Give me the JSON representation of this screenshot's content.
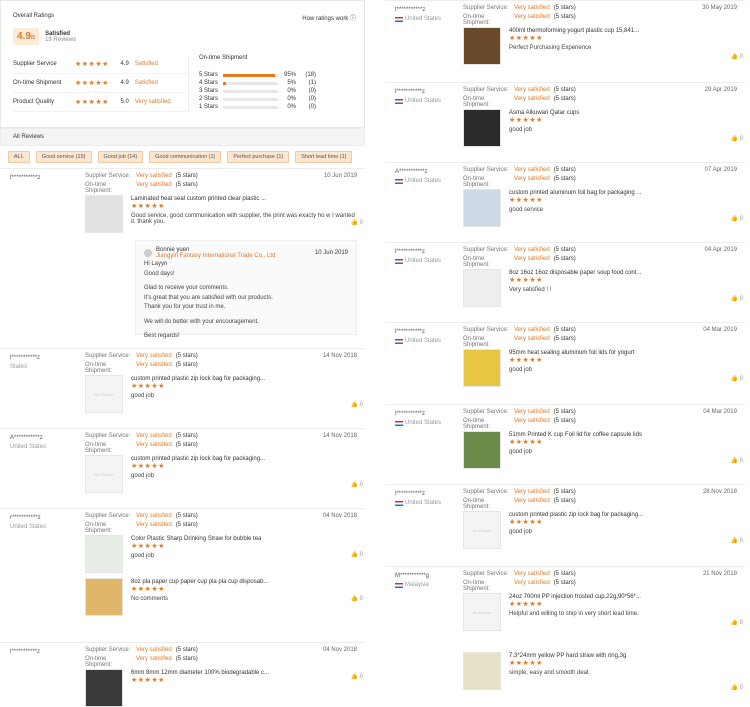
{
  "summary": {
    "title": "Overall Ratings",
    "how_link": "How ratings work",
    "score": "4.9",
    "score_suffix": "/5",
    "score_label": "Satisfied",
    "review_count": "19 Reviews",
    "metrics": [
      {
        "label": "Supplier Service",
        "stars": "★★★★★",
        "value": "4.9",
        "verdict": "Satisfied"
      },
      {
        "label": "On-time Shipment",
        "stars": "★★★★★",
        "value": "4.9",
        "verdict": "Satisfied"
      },
      {
        "label": "Product Quality",
        "stars": "★★★★★",
        "value": "5.0",
        "verdict": "Very satisfied"
      }
    ],
    "distribution_title": "On-time Shipment",
    "distribution": [
      {
        "label": "5 Stars",
        "pct": "95%",
        "count": "(18)",
        "fill": 0.95
      },
      {
        "label": "4 Stars",
        "pct": "5%",
        "count": "(1)",
        "fill": 0.05
      },
      {
        "label": "3 Stars",
        "pct": "0%",
        "count": "(0)",
        "fill": 0
      },
      {
        "label": "2 Stars",
        "pct": "0%",
        "count": "(0)",
        "fill": 0
      },
      {
        "label": "1 Stars",
        "pct": "0%",
        "count": "(0)",
        "fill": 0
      }
    ]
  },
  "all_reviews_label": "All Reviews",
  "filters": [
    "ALL",
    "Good service (15)",
    "Good job (14)",
    "Good communication (1)",
    "Perfect purchase (1)",
    "Short lead time (1)"
  ],
  "labels": {
    "supplier_service": "Supplier Service:",
    "ontime_shipment": "On-time Shipment:",
    "very_satisfied": "Very satisfied",
    "five_stars": "(5 stars)",
    "stars": "★★★★★",
    "no_picture": "No Picture",
    "like": "👍 0"
  },
  "left_reviews": [
    {
      "name": "t***********z",
      "country": "",
      "date": "10 Jun 2019",
      "product": "Laminated heat seal custom printed clear plastic ...",
      "comment": "Good service, good communication with supplier, the print was exacty ho w I wanted it. thank you."
    },
    {
      "name": "l***********z",
      "country": "States",
      "date": "14 Nov 2018",
      "product": "custom printed plastic zip lock bag for packaging...",
      "comment": "good job"
    },
    {
      "name": "A***********z",
      "country": "United States",
      "date": "14 Nov 2018",
      "product": "custom printed plastic zip lock bag for packaging...",
      "comment": "good job"
    },
    {
      "name": "r***********z",
      "country": "United States",
      "date": "04 Nov 2018",
      "product": "Color Plastic Sharp Drinking Straw for bubble tea",
      "comment": "good job"
    },
    {
      "name": "",
      "country": "",
      "date": "",
      "product": "8oz pla paper cup paper cup pla pla cup disposab...",
      "comment": "No comments"
    },
    {
      "name": "l***********z",
      "country": "",
      "date": "04 Nov 2018",
      "product": "6mm 8mm 12mm diameter 100% biodegradable c...",
      "comment": ""
    }
  ],
  "reply": {
    "author": "Bonnie yuen",
    "company": "Jiangyin Fantasy International Trade Co., Ltd",
    "date": "10 Jun 2019",
    "lines": [
      "Hi Layyn",
      "Good days!",
      "",
      "Glad to receive your comments.",
      "It's great that you are satisfied with our products.",
      "Thank you for your trust in me.",
      "",
      "We will do better with your encouragement.",
      "",
      "Best regards!"
    ]
  },
  "right_reviews": [
    {
      "name": "t***********z",
      "country": "United States",
      "date": "30 May 2019",
      "product": "400ml thermoforming yogurt plastic cup 15,841...",
      "comment": "Perfect Purchasing Experience"
    },
    {
      "name": "l***********z",
      "country": "United States",
      "date": "29 Apr 2019",
      "product": "Asma Alkuwari Qatar cups",
      "comment": "good job"
    },
    {
      "name": "A***********z",
      "country": "United States",
      "date": "07 Apr 2019",
      "product": "custom printed aluminum foil bag for packaging ...",
      "comment": "good service"
    },
    {
      "name": "l***********z",
      "country": "United States",
      "date": "04 Apr 2019",
      "product": "8oz 16oz 16oz disposable paper soup food cont...",
      "comment": "Very satisfied ! !"
    },
    {
      "name": "l***********z",
      "country": "United States",
      "date": "04 Mar 2019",
      "product": "95mm heat sealing aluminum foil lids for yogurt",
      "comment": "good job"
    },
    {
      "name": "l***********z",
      "country": "United States",
      "date": "04 Mar 2019",
      "product": "51mm Printed K cup Foil lid for coffee capsule lids",
      "comment": "good job"
    },
    {
      "name": "l***********z",
      "country": "United States",
      "date": "28 Nov 2018",
      "product": "custom printed plastic zip lock bag for packaging...",
      "comment": "good job"
    },
    {
      "name": "M***********g",
      "country": "Malaysia",
      "date": "21 Nov 2018",
      "product": "24oz 700ml PP injection frosted cup,22g,90*56*...",
      "comment": "Helpful and willing to ship in very short lead time."
    },
    {
      "name": "",
      "country": "",
      "date": "",
      "product": "7.3*24mm yellow PP hard straw with ring,3g",
      "comment": "simple, easy and smooth deal."
    }
  ]
}
